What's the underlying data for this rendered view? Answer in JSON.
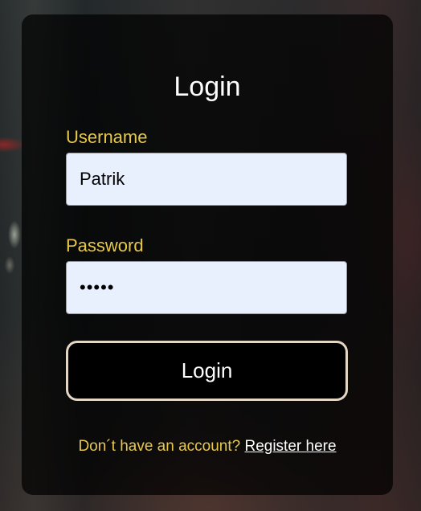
{
  "login_card": {
    "title": "Login",
    "username": {
      "label": "Username",
      "value": "Patrik"
    },
    "password": {
      "label": "Password",
      "value": "•••••"
    },
    "submit_label": "Login",
    "footer": {
      "prompt": "Don´t have an account?",
      "register_link": "Register here"
    }
  },
  "colors": {
    "label_accent": "#e7c84a",
    "input_background": "#e8f0fe",
    "button_border": "#e3d6c4"
  }
}
